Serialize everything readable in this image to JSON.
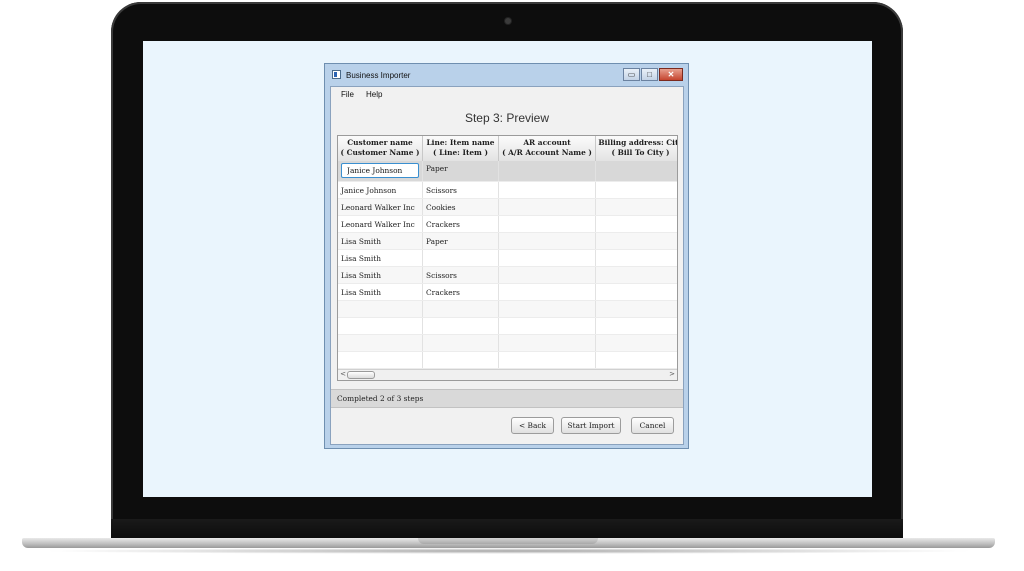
{
  "window": {
    "title": "Business Importer",
    "controls": {
      "minimize": "▭",
      "maximize": "□",
      "close": "✕"
    }
  },
  "menu": {
    "items": [
      "File",
      "Help"
    ]
  },
  "step_title": "Step 3: Preview",
  "table": {
    "columns": [
      {
        "title": "Customer name",
        "subtitle": "( Customer Name )"
      },
      {
        "title": "Line: Item name",
        "subtitle": "( Line: Item )"
      },
      {
        "title": "AR account",
        "subtitle": "( A/R Account Name )"
      },
      {
        "title": "Billing address: City",
        "subtitle": "( Bill To City )"
      }
    ],
    "editing_value": "Janice Johnson",
    "rows": [
      [
        "",
        "Paper",
        "",
        ""
      ],
      [
        "Janice Johnson",
        "Scissors",
        "",
        ""
      ],
      [
        "Leonard Walker Inc",
        "Cookies",
        "",
        ""
      ],
      [
        "Leonard Walker Inc",
        "Crackers",
        "",
        ""
      ],
      [
        "Lisa Smith",
        "Paper",
        "",
        ""
      ],
      [
        "Lisa Smith",
        "",
        "",
        ""
      ],
      [
        "Lisa Smith",
        "Scissors",
        "",
        ""
      ],
      [
        "Lisa Smith",
        "Crackers",
        "",
        ""
      ],
      [
        "",
        "",
        "",
        ""
      ],
      [
        "",
        "",
        "",
        ""
      ],
      [
        "",
        "",
        "",
        ""
      ],
      [
        "",
        "",
        "",
        ""
      ]
    ],
    "scroll_left": "<",
    "scroll_right": ">"
  },
  "status": "Completed 2 of 3 steps",
  "buttons": {
    "back": "< Back",
    "start_import": "Start Import",
    "cancel": "Cancel"
  },
  "colors": {
    "screen_bg": "#eaf5fd",
    "focus_border": "#3a8fd0",
    "title_bar": "#b9d1ea"
  }
}
